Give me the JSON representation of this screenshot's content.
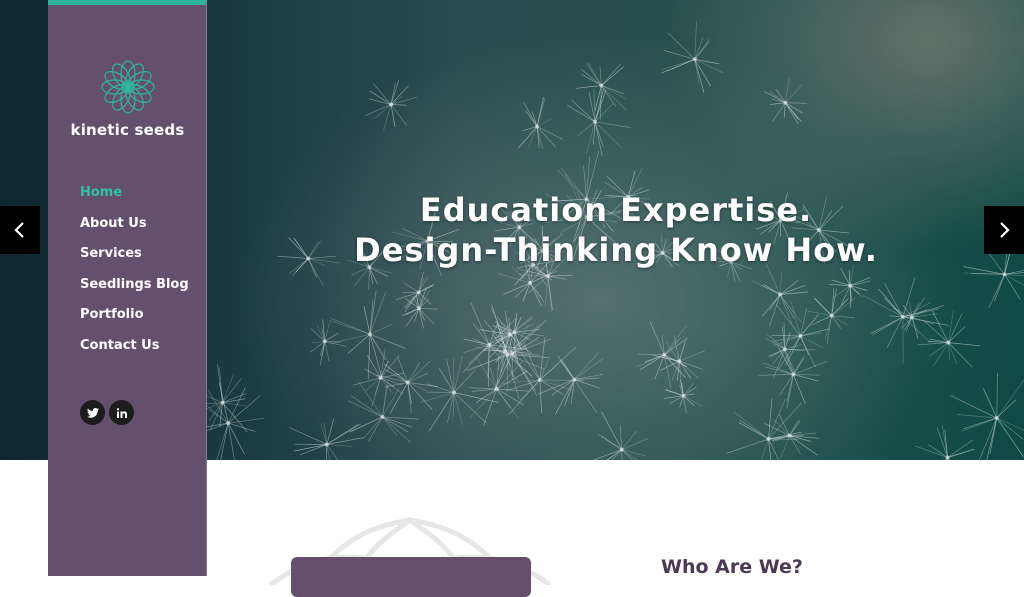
{
  "brand": {
    "name": "kinetic seeds",
    "logo_icon": "mandala-flower-icon",
    "accent_color": "#2fb59a",
    "sidebar_color": "#644f6c"
  },
  "nav": {
    "items": [
      {
        "label": "Home",
        "active": true
      },
      {
        "label": "About Us",
        "active": false
      },
      {
        "label": "Services",
        "active": false
      },
      {
        "label": "Seedlings Blog",
        "active": false
      },
      {
        "label": "Portfolio",
        "active": false
      },
      {
        "label": "Contact Us",
        "active": false
      }
    ]
  },
  "social": {
    "icons": [
      "twitter-icon",
      "linkedin-icon"
    ]
  },
  "hero": {
    "line1": "Education Expertise.",
    "line2": "Design-Thinking Know How.",
    "background": "dandelion-photo",
    "prev_icon": "chevron-left-icon",
    "next_icon": "chevron-right-icon"
  },
  "about": {
    "heading": "Who Are We?"
  }
}
